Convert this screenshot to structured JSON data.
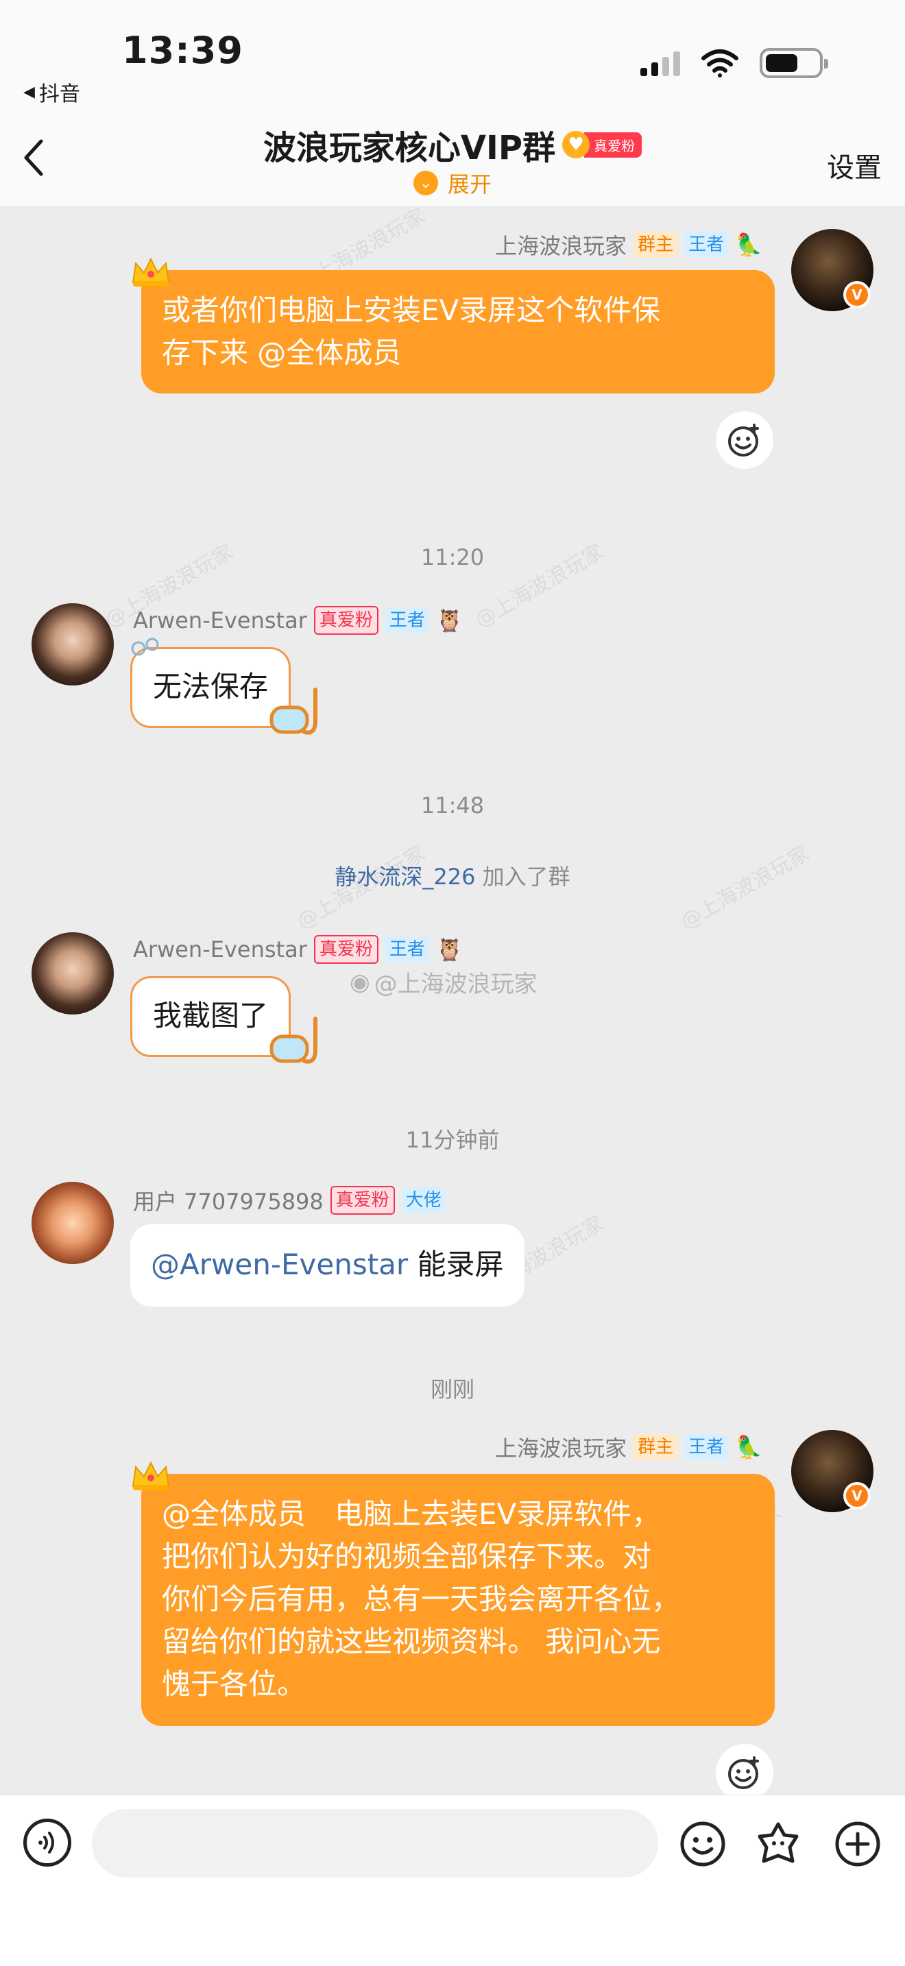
{
  "status_bar": {
    "time": "13:39",
    "back_app": "抖音"
  },
  "header": {
    "title": "波浪玩家核心VIP群",
    "fan_badge": "真爱粉",
    "expand_label": "展开",
    "settings_label": "设置"
  },
  "watermark_text": "@上海波浪玩家",
  "messages": [
    {
      "sender": "上海波浪玩家",
      "tags": [
        "群主",
        "王者"
      ],
      "text": "或者你们电脑上安装EV录屏这个软件保存下来 @全体成员",
      "line1": "或者你们电脑上安装EV录屏这个软件保",
      "line2": "存下来 @全体成员"
    },
    {
      "time": "11:20"
    },
    {
      "sender": "Arwen-Evenstar",
      "tags": [
        "真爱粉",
        "王者"
      ],
      "text": "无法保存"
    },
    {
      "time": "11:48"
    },
    {
      "system": {
        "name": "静水流深_226",
        "action": "加入了群"
      }
    },
    {
      "sender": "Arwen-Evenstar",
      "tags": [
        "真爱粉",
        "王者"
      ],
      "text": "我截图了"
    },
    {
      "time": "11分钟前"
    },
    {
      "sender": "用户 7707975898",
      "tags": [
        "真爱粉",
        "大佬"
      ],
      "mention": "@Arwen-Evenstar",
      "text": "能录屏"
    },
    {
      "time": "刚刚"
    },
    {
      "sender": "上海波浪玩家",
      "tags": [
        "群主",
        "王者"
      ],
      "lines": [
        "@全体成员　电脑上去装EV录屏软件，",
        "把你们认为好的视频全部保存下来。对",
        "你们今后有用，总有一天我会离开各位，",
        "留给你们的就这些视频资料。 我问心无",
        "愧于各位。"
      ]
    }
  ],
  "weibo_watermark": "@上海波浪玩家",
  "colors": {
    "orange_bubble": "#ff9d26",
    "accent": "#f08a00",
    "mention": "#3e6aa6"
  },
  "icons": [
    "voice-icon",
    "emoji-icon",
    "sticker-icon",
    "plus-icon",
    "react-emoji-icon",
    "back-chevron-icon"
  ]
}
